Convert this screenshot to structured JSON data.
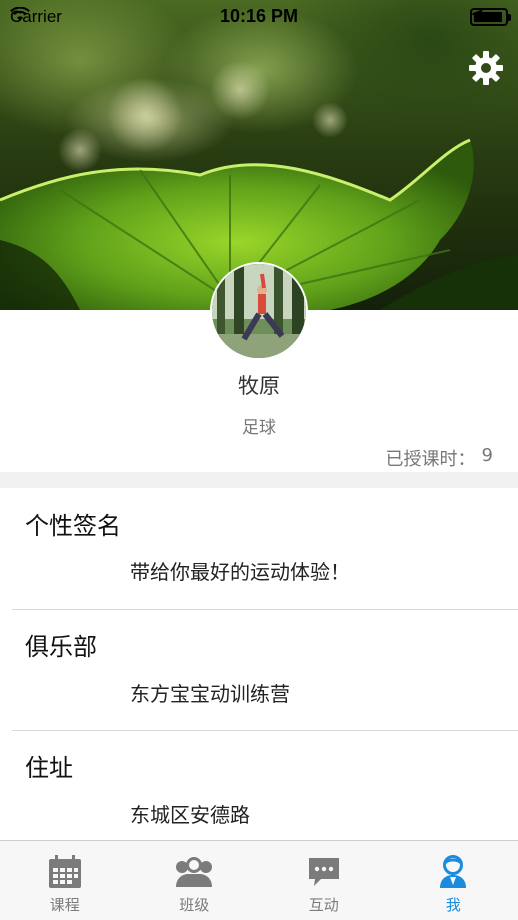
{
  "status_bar": {
    "carrier": "Carrier",
    "time": "10:16 PM",
    "battery_level": 0.92
  },
  "header": {
    "settings_icon": "gear-icon",
    "background_image": "green-leaf-photo"
  },
  "profile": {
    "avatar": "person-yoga-pose-photo",
    "name": "牧原",
    "sport": "足球",
    "hours_label": "已授课时：",
    "hours_value": "9"
  },
  "sections": [
    {
      "title": "个性签名",
      "value": "带给你最好的运动体验！"
    },
    {
      "title": "俱乐部",
      "value": "东方宝宝动训练营"
    },
    {
      "title": "住址",
      "value": "东城区安德路"
    }
  ],
  "tabbar": {
    "accent_color": "#1a8ce0",
    "inactive_color": "#7b7b7b",
    "tabs": [
      {
        "label": "课程",
        "icon": "calendar-icon",
        "active": false
      },
      {
        "label": "班级",
        "icon": "group-icon",
        "active": false
      },
      {
        "label": "互动",
        "icon": "chat-icon",
        "active": false
      },
      {
        "label": "我",
        "icon": "person-icon",
        "active": true
      }
    ]
  }
}
